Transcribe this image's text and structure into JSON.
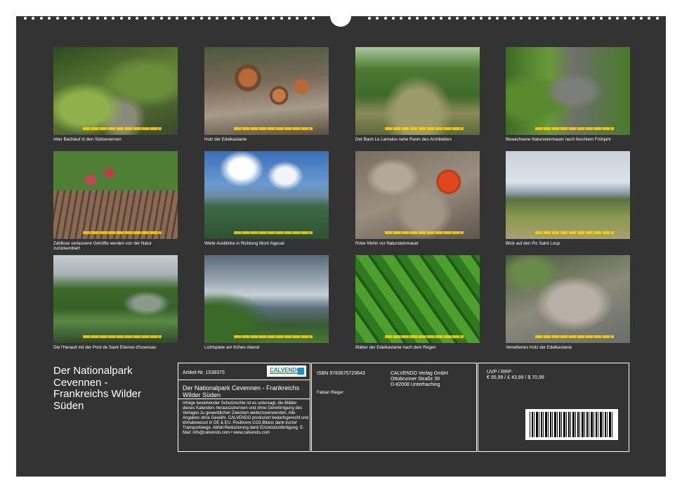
{
  "photos": [
    {
      "caption": "Alter Bachlauf in den Südcevennen"
    },
    {
      "caption": "Holz der Edelkastanie"
    },
    {
      "caption": "Der Bach Le Lamalou nahe Ravin des Architekten"
    },
    {
      "caption": "Bewachsene Natursteinmauer nach feuchtem Frühjahr"
    },
    {
      "caption": "Zahllose verlassene Gehöfte werden von der Natur zurückerobert"
    },
    {
      "caption": "Weite Ausblicke in Richtung Mont Aigoual"
    },
    {
      "caption": "Roter Mohn vor Natursteinmauer"
    },
    {
      "caption": "Blick auf den Pic Saint Loup"
    },
    {
      "caption": "Die l'Herault mit der Pont de Saint Etienne d'Issensac"
    },
    {
      "caption": "Lichtspiele am frühen Abend"
    },
    {
      "caption": "Blätter der Edelkastanie nach dem Regen"
    },
    {
      "caption": "Verwittertes Holz der Edelkastanie"
    }
  ],
  "calendar_title": "Der Nationalpark Cevennen - Frankreichs Wilder Süden",
  "info": {
    "article_no": "Artikel-Nr. 1538375",
    "logo_text": "CALVENDO",
    "product_title": "Der Nationalpark Cevennen - Frankreichs Wilder Süden",
    "legal_text": "Infolge bestehender Schutzrechte ist es untersagt, die Blätter dieses Kalenders herauszutrennen und ohne Genehmigung des Verlages zu gewerblichen Zwecken weiterzuverwenden. Alle Angaben ohne Gewähr. CALVENDO produziert bedarfsgerecht und klimabewusst in DE & EU. Positivere CO2-Bilanz dank kurzer Transportwege. Abfall-Reduzierung dank Einzelstückfertigung. E-Mail: info@calvendo.com • www.calvendo.com",
    "isbn": "ISBN 9783675729643",
    "publisher_name": "CALVENDO Verlag GmbH",
    "publisher_street": "Ottobrunner Straße 39",
    "publisher_city": "D-82008 Unterhaching",
    "author": "Fabian Rieger",
    "price_label": "UVP / RRP:",
    "price_values": "€ 55,99 / £ 43,99 / $ 70,99"
  }
}
